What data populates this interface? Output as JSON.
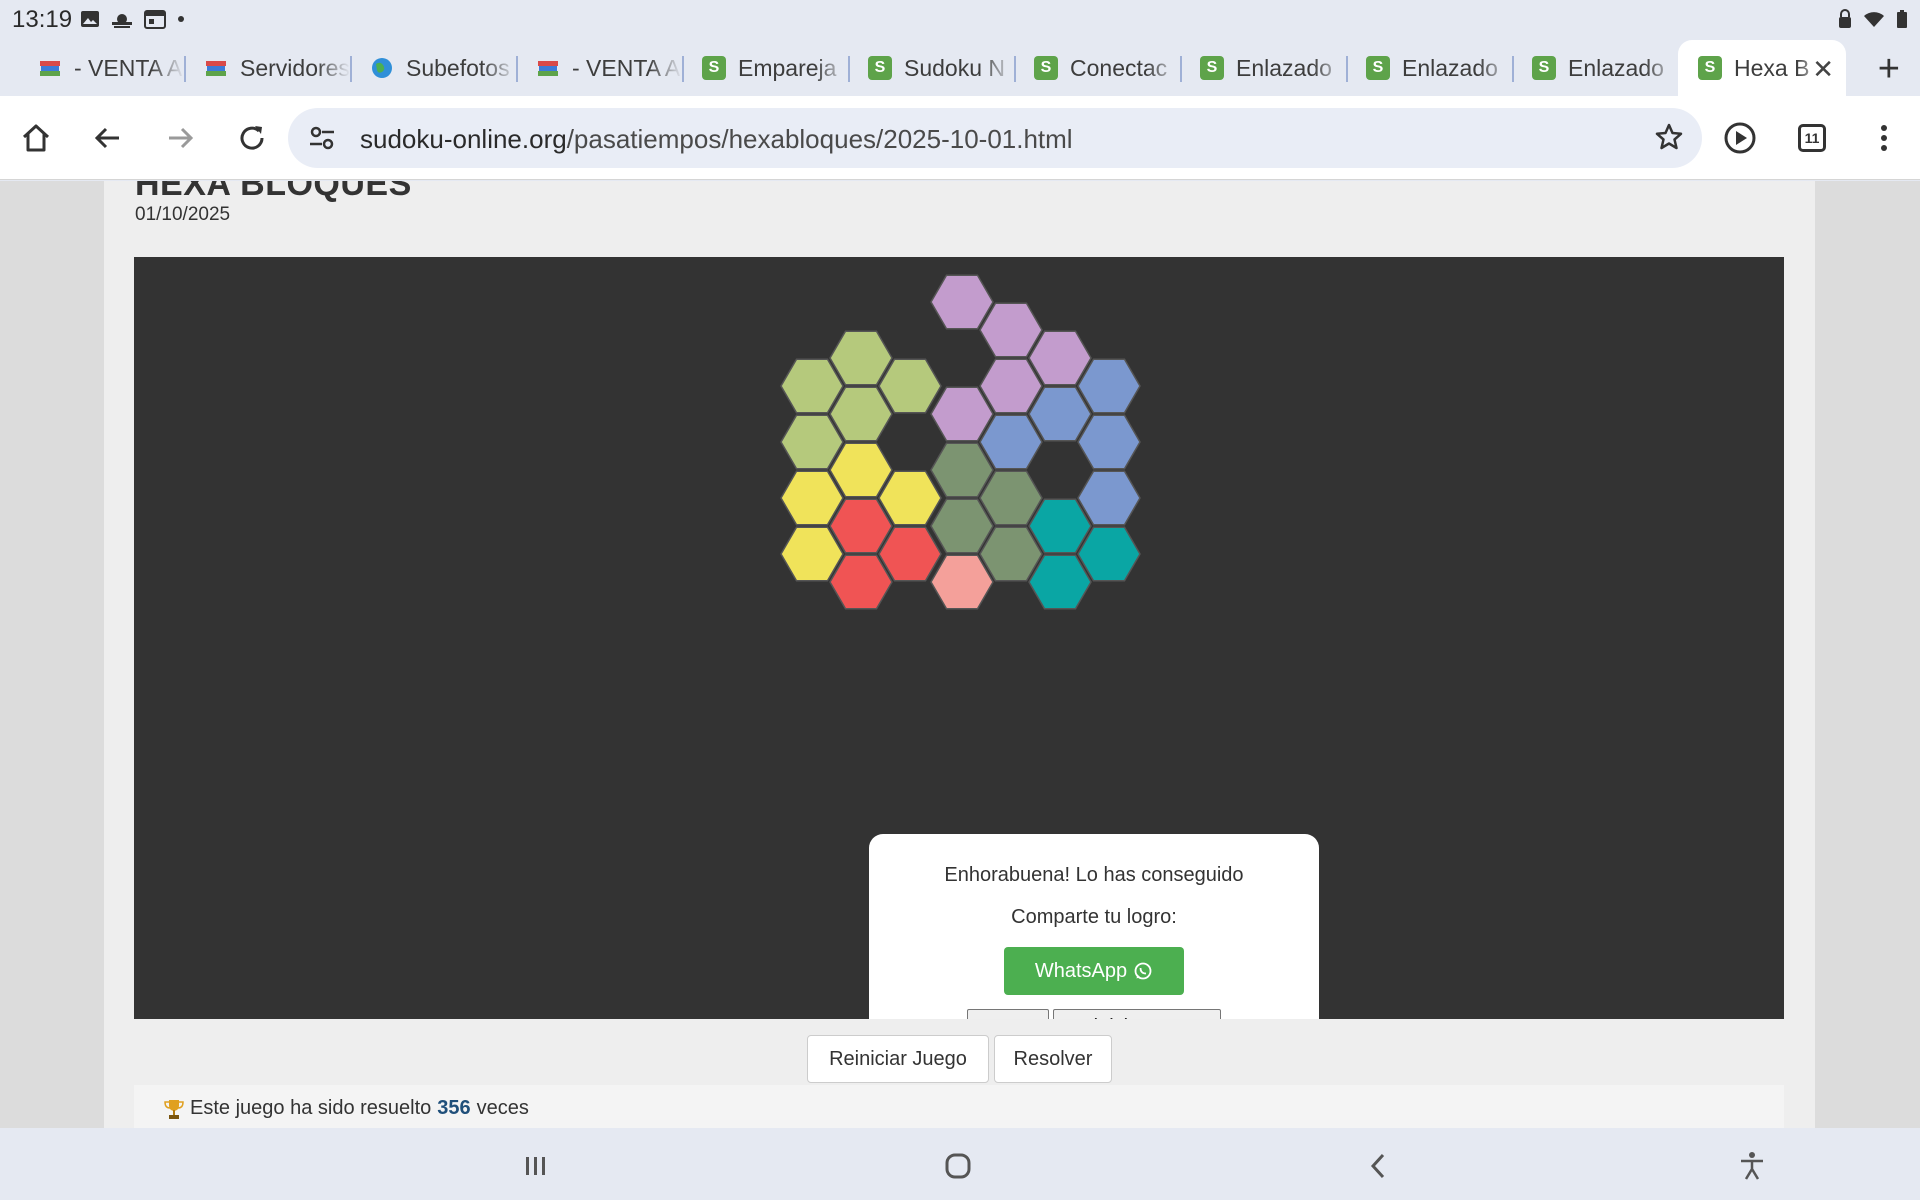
{
  "status_bar": {
    "time": "13:19"
  },
  "tabs": [
    {
      "title": "- VENTA A",
      "favicon": "book-icon"
    },
    {
      "title": "Servidores",
      "favicon": "book-icon"
    },
    {
      "title": "Subefotos",
      "favicon": "globe-icon"
    },
    {
      "title": "- VENTA A",
      "favicon": "book-icon"
    },
    {
      "title": "Empareja",
      "favicon": "S"
    },
    {
      "title": "Sudoku N",
      "favicon": "S"
    },
    {
      "title": "Conectac",
      "favicon": "S"
    },
    {
      "title": "Enlazado",
      "favicon": "S"
    },
    {
      "title": "Enlazado",
      "favicon": "S"
    },
    {
      "title": "Enlazado",
      "favicon": "S"
    },
    {
      "title": "Hexa B",
      "favicon": "S",
      "active": true
    }
  ],
  "toolbar": {
    "url_host": "sudoku-online.org",
    "url_path": "/pasatiempos/hexabloques/2025-10-01.html",
    "tab_count": "11"
  },
  "page": {
    "title": "HEXA BLOQUES",
    "date": "01/10/2025"
  },
  "modal": {
    "message": "Enhorabuena! Lo has conseguido",
    "share_label": "Comparte tu logro:",
    "whatsapp_label": "WhatsApp",
    "close_label": "Cerrar",
    "restart_label": "Reiniciar Juego"
  },
  "controls": {
    "restart_label": "Reiniciar Juego",
    "solve_label": "Resolver"
  },
  "footer": {
    "prefix": "Este juego ha sido resuelto",
    "count": "356",
    "suffix": "veces"
  },
  "puzzle_colors": {
    "lime": "#b5c97c",
    "yellow": "#f0e35a",
    "red": "#f05454",
    "pink": "#f4a09a",
    "olive": "#7c9471",
    "lavender": "#c39ccd",
    "blue": "#7b98cf",
    "teal": "#0aa6a4"
  }
}
